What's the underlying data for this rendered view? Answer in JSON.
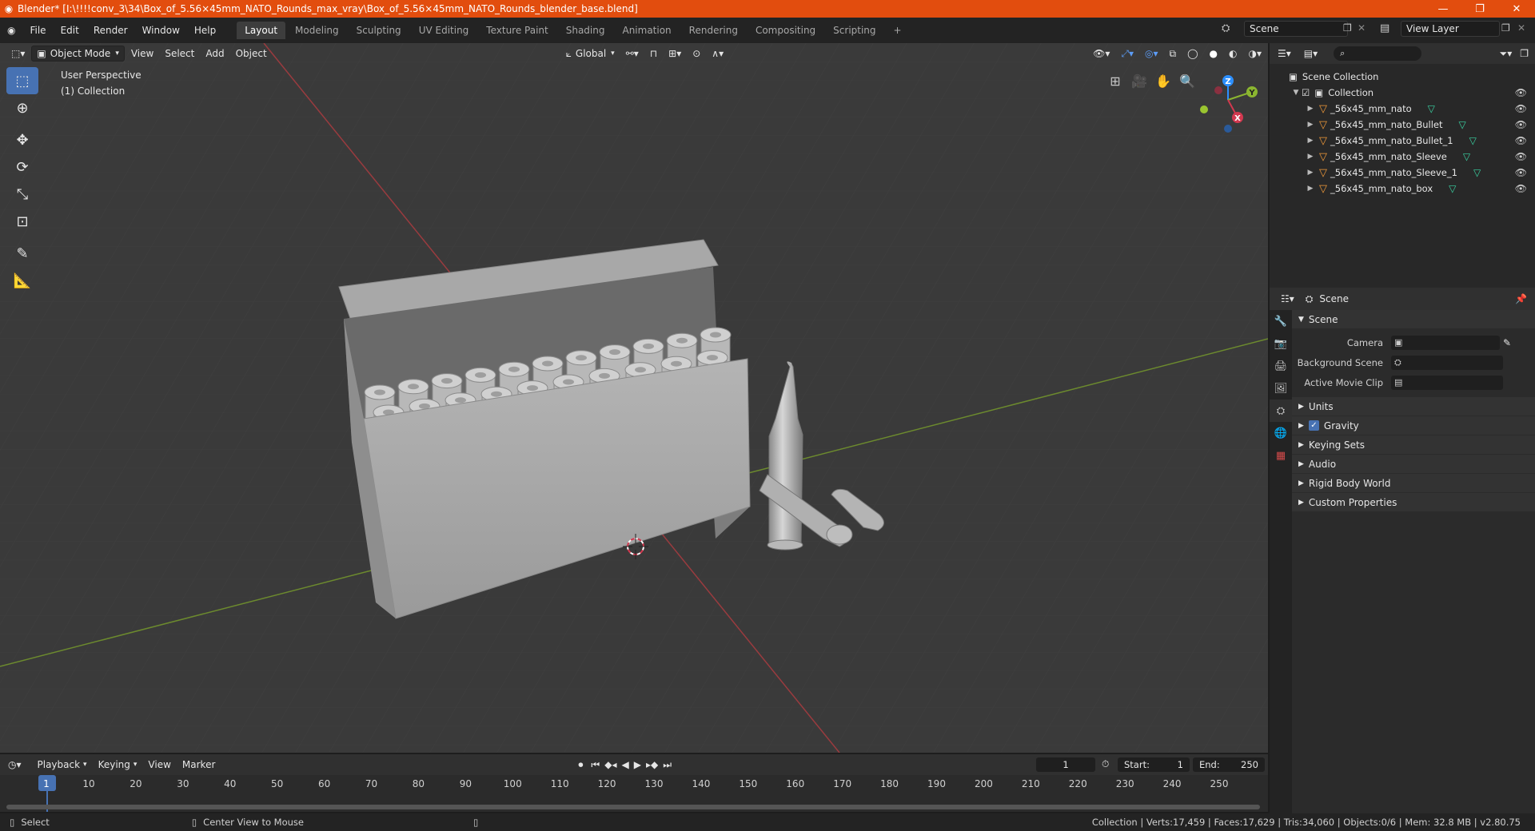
{
  "window": {
    "title": "Blender* [I:\\!!!!conv_3\\34\\Box_of_5.56×45mm_NATO_Rounds_max_vray\\Box_of_5.56×45mm_NATO_Rounds_blender_base.blend]",
    "minimize": "—",
    "maximize": "❐",
    "close": "✕"
  },
  "menu": [
    "File",
    "Edit",
    "Render",
    "Window",
    "Help"
  ],
  "workspaces": [
    "Layout",
    "Modeling",
    "Sculpting",
    "UV Editing",
    "Texture Paint",
    "Shading",
    "Animation",
    "Rendering",
    "Compositing",
    "Scripting"
  ],
  "add_workspace": "+",
  "scene_name": "Scene",
  "view_layer": "View Layer",
  "viewport": {
    "mode": "Object Mode",
    "menus": [
      "View",
      "Select",
      "Add",
      "Object"
    ],
    "orientation": "Global",
    "perspective": "User Perspective",
    "collection_info": "(1) Collection",
    "gizmo": {
      "x": "X",
      "y": "Y",
      "z": "Z"
    }
  },
  "outliner": {
    "root": "Scene Collection",
    "collection": "Collection",
    "items": [
      "_56x45_mm_nato",
      "_56x45_mm_nato_Bullet",
      "_56x45_mm_nato_Bullet_1",
      "_56x45_mm_nato_Sleeve",
      "_56x45_mm_nato_Sleeve_1",
      "_56x45_mm_nato_box"
    ]
  },
  "properties": {
    "header": "Scene",
    "panel": "Scene",
    "camera_label": "Camera",
    "background_scene_label": "Background Scene",
    "active_clip_label": "Active Movie Clip",
    "sections": [
      "Units",
      "Gravity",
      "Keying Sets",
      "Audio",
      "Rigid Body World",
      "Custom Properties"
    ],
    "gravity_checked": true
  },
  "timeline": {
    "menus": [
      "Playback",
      "Keying",
      "View",
      "Marker"
    ],
    "current_frame": "1",
    "start_label": "Start:",
    "start": "1",
    "end_label": "End:",
    "end": "250",
    "ticks": [
      "1",
      "10",
      "20",
      "30",
      "40",
      "50",
      "60",
      "70",
      "80",
      "90",
      "100",
      "110",
      "120",
      "130",
      "140",
      "150",
      "160",
      "170",
      "180",
      "190",
      "200",
      "210",
      "220",
      "230",
      "240",
      "250"
    ]
  },
  "status": {
    "select": "Select",
    "center_view": "Center View to Mouse",
    "stats": "Collection | Verts:17,459 | Faces:17,629 | Tris:34,060 | Objects:0/6 | Mem: 32.8 MB | v2.80.75"
  },
  "colors": {
    "title_bar": "#e24d0e",
    "accent": "#4772b3",
    "x_axis": "#d2384f",
    "y_axis": "#8bb630",
    "z_axis": "#2c8fff"
  }
}
